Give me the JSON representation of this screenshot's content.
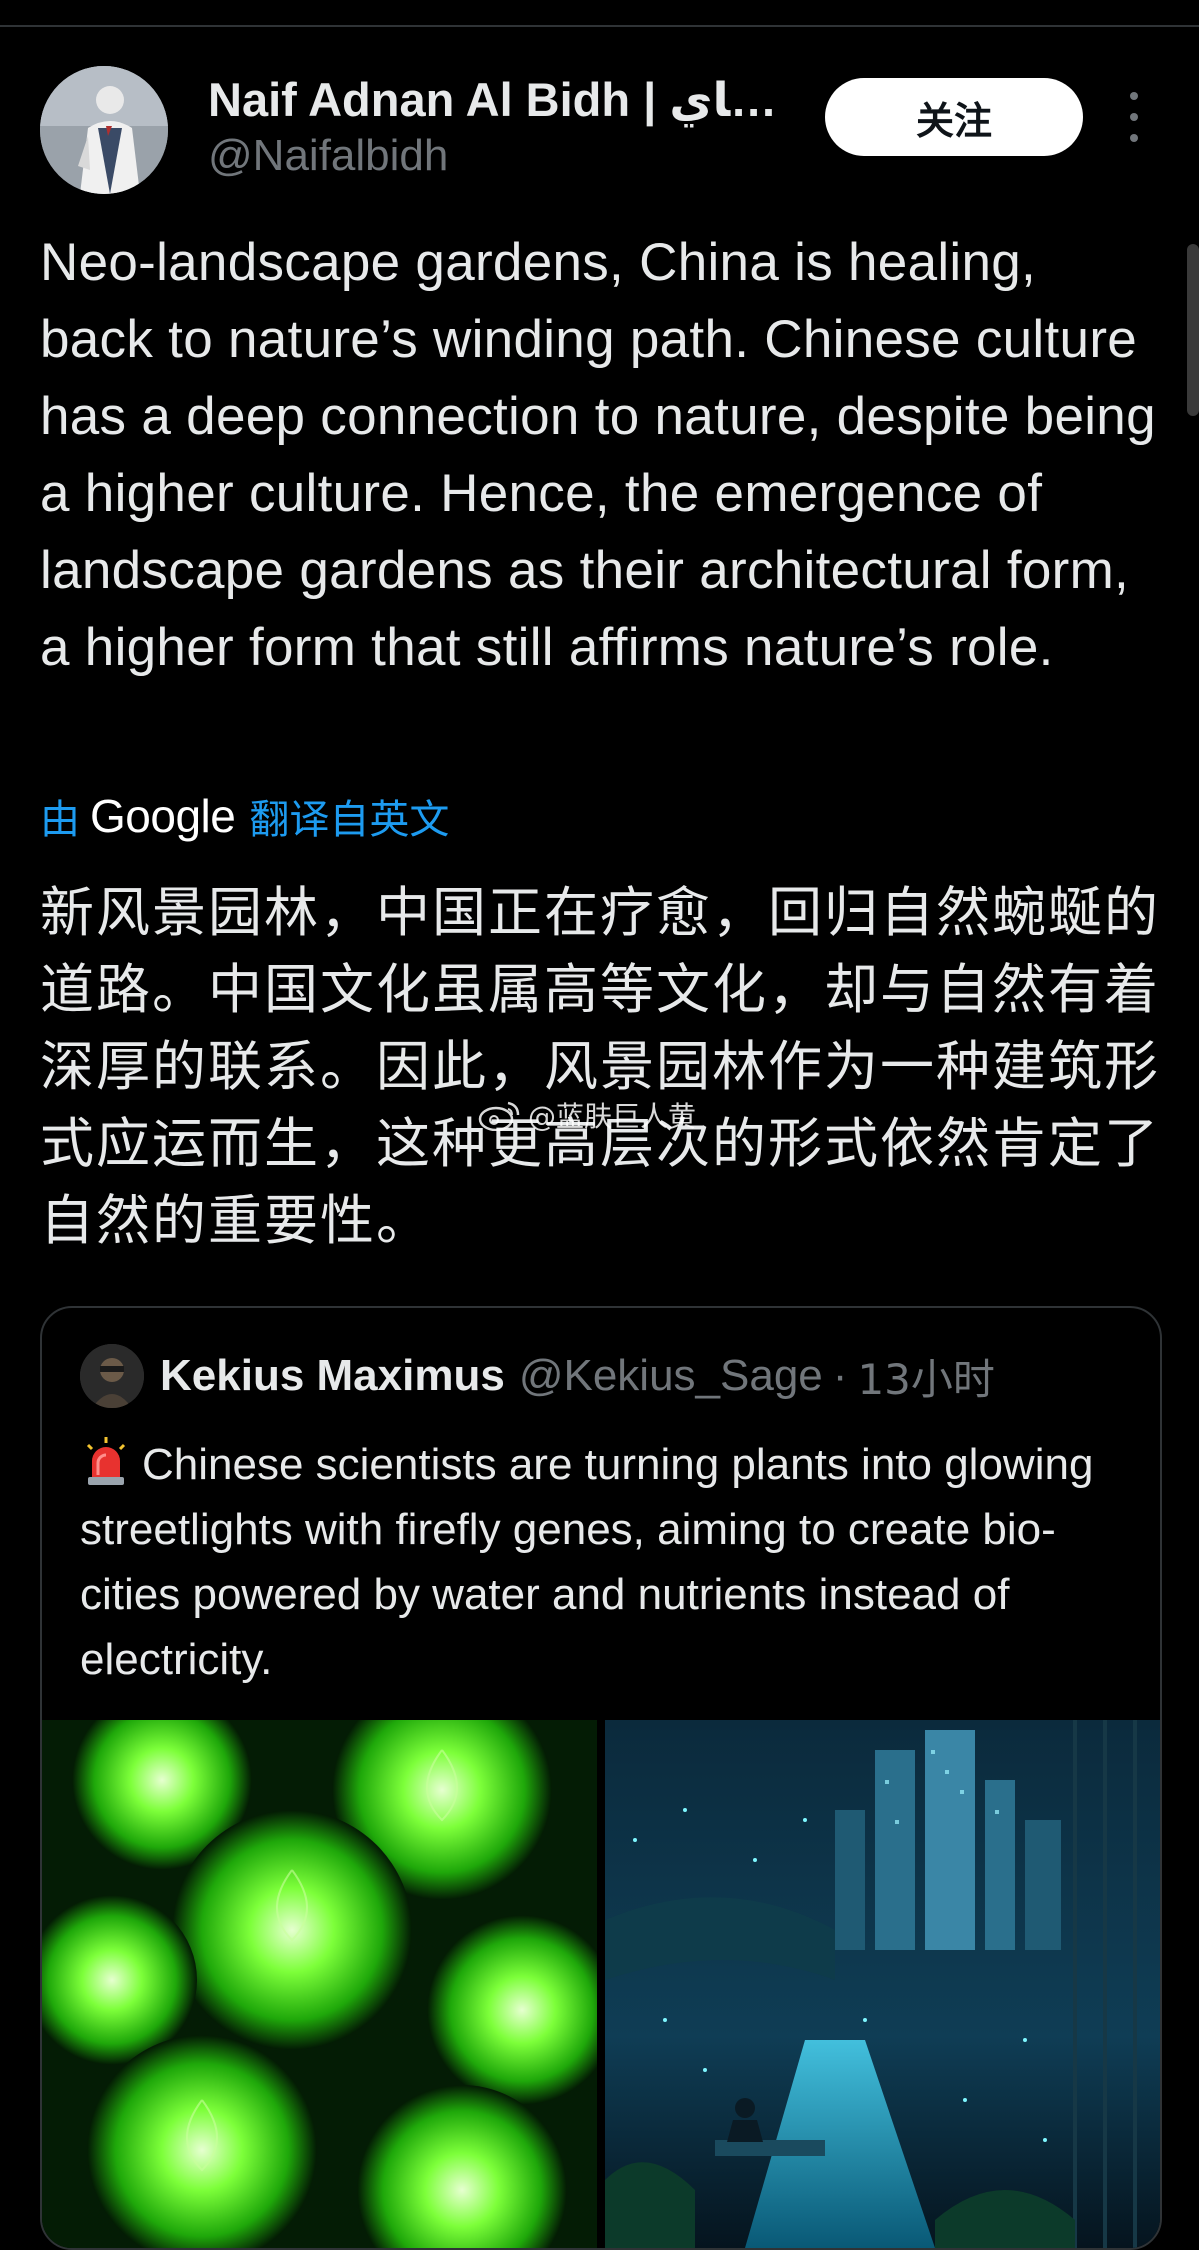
{
  "author": {
    "display_name": "Naif Adnan Al Bidh | ناي...",
    "handle": "@Naifalbidh",
    "avatar_icon": "avatar-figure-icon"
  },
  "actions": {
    "follow_label": "关注",
    "more_icon": "more-dots-icon"
  },
  "post": {
    "text": "Neo-landscape gardens, China is healing, back to nature’s winding path. Chinese culture has a deep connection to nature, despite being a higher culture. Hence, the emergence of landscape gardens as their architectural form, a higher form that still affirms nature’s role.",
    "translation_by": "由",
    "translation_provider": "Google",
    "translation_label": "翻译自英文",
    "translated_text": "新风景园林，中国正在疗愈，回归自然蜿蜒的道路。中国文化虽属高等文化，却与自然有着深厚的联系。因此，风景园林作为一种建筑形式应运而生，这种更高层次的形式依然肯定了自然的重要性。"
  },
  "watermark": {
    "text": "@蓝肤巨人黄"
  },
  "quoted": {
    "name": "Kekius Maximus",
    "handle": "@Kekius_Sage",
    "separator": "·",
    "time": "13小时",
    "text": "Chinese scientists are turning plants into glowing streetlights with firefly genes, aiming to create bio-cities powered by water and nutrients instead of electricity.",
    "emoji_icon": "siren-icon",
    "media": [
      "glowing-succulents-image",
      "glowing-city-park-image"
    ]
  },
  "colors": {
    "background": "#000000",
    "text_primary": "#e7e9ea",
    "text_secondary": "#71767b",
    "link_blue": "#1d9bf0",
    "follow_bg": "#ffffff"
  }
}
